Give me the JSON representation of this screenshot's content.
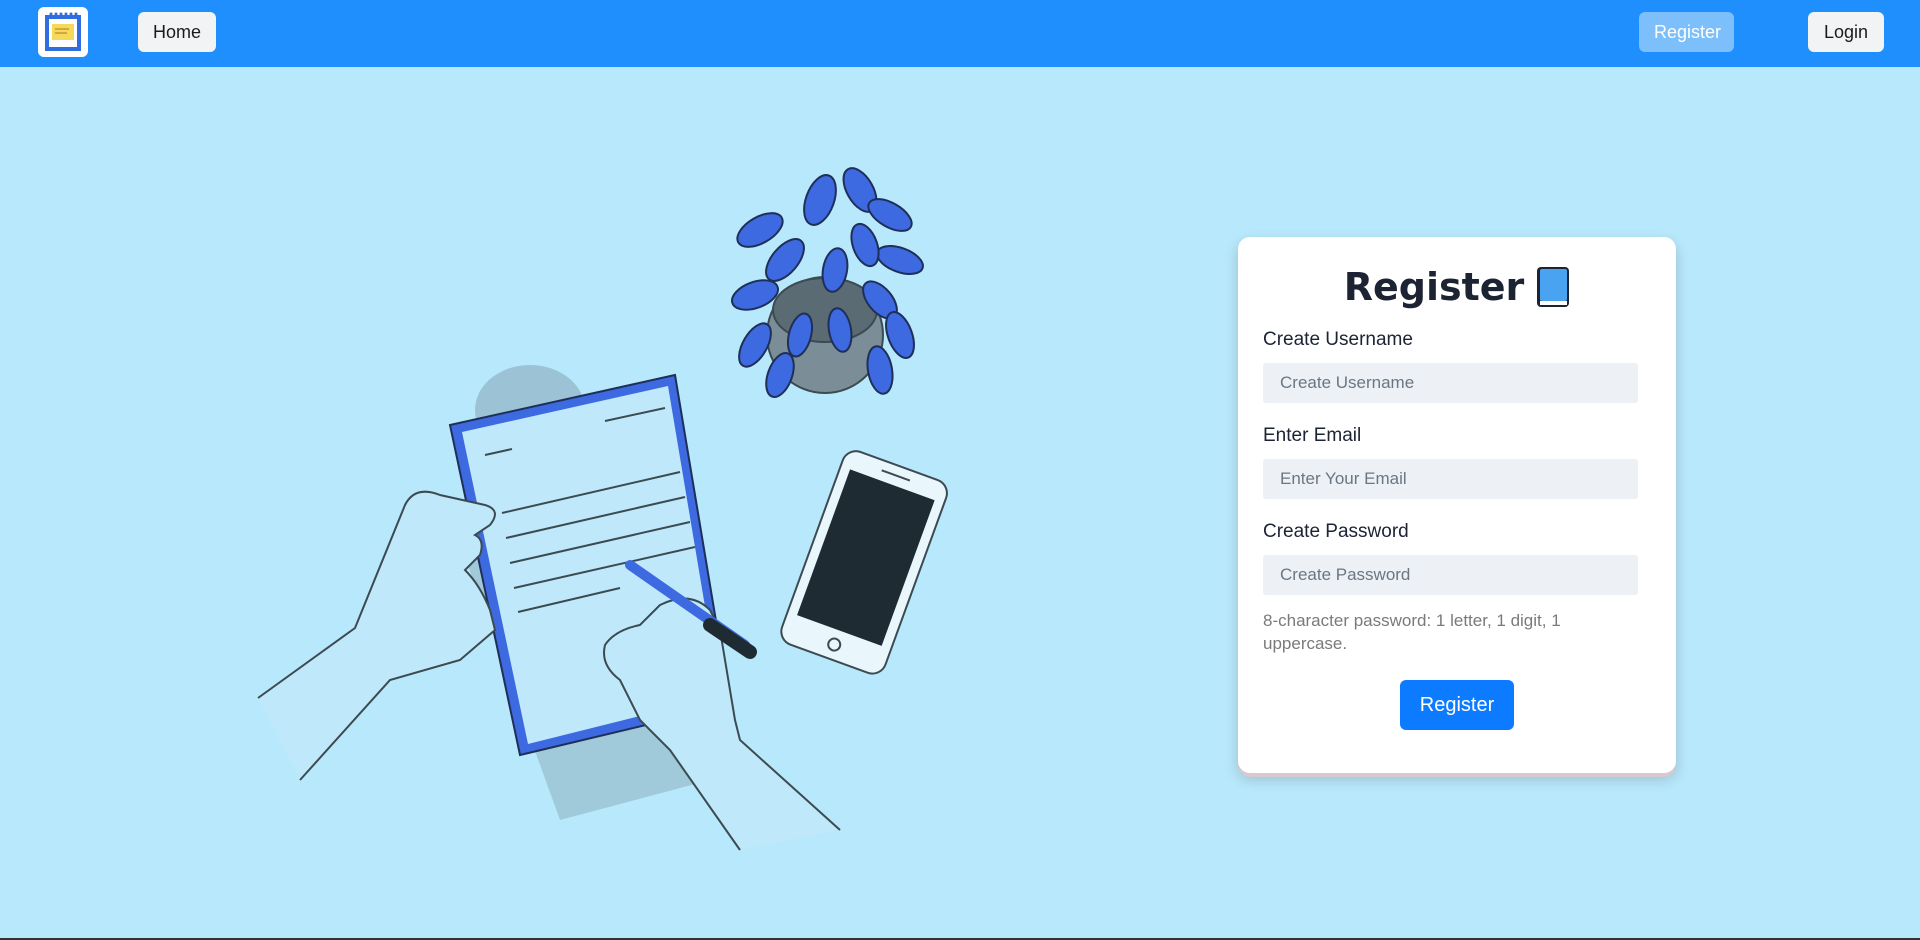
{
  "navbar": {
    "logo_icon": "notepad-logo-icon",
    "home_label": "Home",
    "register_label": "Register",
    "login_label": "Login",
    "background_color": "#1e8ffd"
  },
  "form": {
    "title": "Register",
    "title_icon": "blue-book-icon",
    "username_label": "Create Username",
    "username_placeholder": "Create Username",
    "email_label": "Enter Email",
    "email_placeholder": "Enter Your Email",
    "password_label": "Create Password",
    "password_placeholder": "Create Password",
    "password_hint": "8-character password: 1 letter, 1 digit, 1 uppercase.",
    "submit_label": "Register",
    "accent_color": "#0d7bff"
  },
  "illustration": {
    "icon": "hands-writing-document-illustration"
  },
  "page": {
    "background_color": "#b8e8fb"
  }
}
